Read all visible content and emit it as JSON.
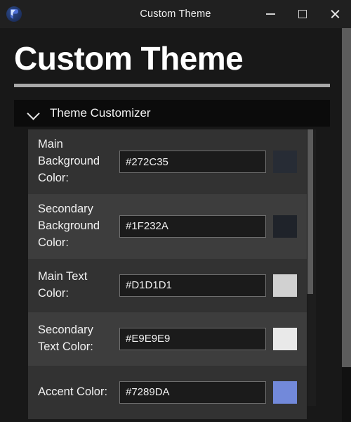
{
  "window": {
    "title": "Custom Theme",
    "app_icon": "app-logo-icon",
    "controls": {
      "minimize": "minimize-button",
      "maximize": "maximize-button",
      "close": "close-button"
    }
  },
  "page": {
    "heading": "Custom Theme"
  },
  "section": {
    "title": "Theme Customizer",
    "expanded": true,
    "chevron_icon": "chevron-down-icon"
  },
  "theme_rows": [
    {
      "label": "Main Background Color:",
      "value": "#272C35",
      "swatch": "#272C35",
      "stripe": "dark"
    },
    {
      "label": "Secondary Background Color:",
      "value": "#1F232A",
      "swatch": "#1F232A",
      "stripe": "light"
    },
    {
      "label": "Main Text Color:",
      "value": "#D1D1D1",
      "swatch": "#D1D1D1",
      "stripe": "dark"
    },
    {
      "label": "Secondary Text Color:",
      "value": "#E9E9E9",
      "swatch": "#E9E9E9",
      "stripe": "light"
    },
    {
      "label": "Accent Color:",
      "value": "#7289DA",
      "swatch": "#7289DA",
      "stripe": "dark"
    }
  ],
  "colors": {
    "titlebar_bg": "#202020",
    "page_bg": "#181818",
    "section_header_bg": "#0B0B0B",
    "rule": "#A8A8A8",
    "row_dark": "#323232",
    "row_light": "#3D3D3D",
    "input_bg": "#1B1B1B",
    "input_border": "#6E6E6E",
    "scrollbar_thumb": "#5C5C5C"
  }
}
